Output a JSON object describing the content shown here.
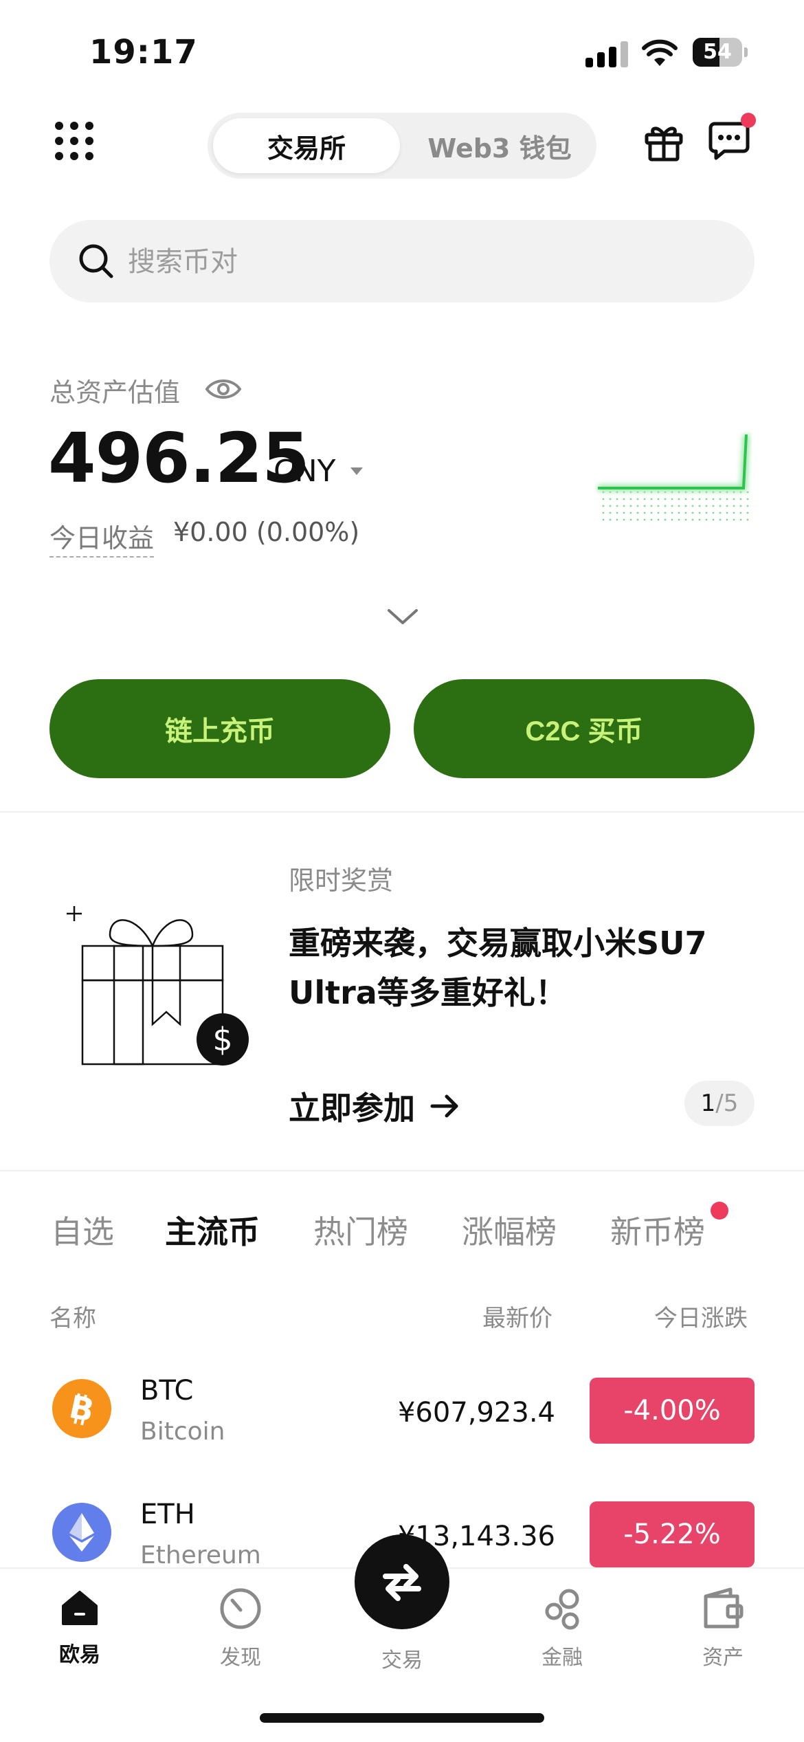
{
  "status_bar": {
    "time": "19:17",
    "battery": "54",
    "battery_level": 0.54
  },
  "header": {
    "tabs": [
      {
        "label": "交易所",
        "active": true
      },
      {
        "label": "Web3 钱包",
        "active": false
      }
    ]
  },
  "search": {
    "placeholder": "搜索币对"
  },
  "assets": {
    "label": "总资产估值",
    "value": "496.25",
    "currency": "CNY",
    "pnl_label": "今日收益",
    "pnl_value": "¥0.00 (0.00%)"
  },
  "actions": {
    "deposit": "链上充币",
    "buy": "C2C 买币"
  },
  "promo": {
    "subtitle": "限时奖赏",
    "title": "重磅来袭，交易赢取小米SU7 Ultra等多重好礼！",
    "cta": "立即参加",
    "page_current": "1",
    "page_total": "5"
  },
  "market_tabs": [
    {
      "label": "自选",
      "active": false
    },
    {
      "label": "主流币",
      "active": true
    },
    {
      "label": "热门榜",
      "active": false
    },
    {
      "label": "涨幅榜",
      "active": false
    },
    {
      "label": "新币榜",
      "active": false,
      "badge": true
    }
  ],
  "columns": {
    "name": "名称",
    "price": "最新价",
    "change": "今日涨跌"
  },
  "coins": [
    {
      "symbol": "BTC",
      "name": "Bitcoin",
      "price": "¥607,923.4",
      "change": "-4.00%",
      "icon": "bitcoin-icon",
      "color": "#f7931a"
    },
    {
      "symbol": "ETH",
      "name": "Ethereum",
      "price": "¥13,143.36",
      "change": "-5.22%",
      "icon": "ethereum-icon",
      "color": "#627eea"
    }
  ],
  "nav": [
    {
      "label": "欧易",
      "active": true
    },
    {
      "label": "发现"
    },
    {
      "label": "交易"
    },
    {
      "label": "金融"
    },
    {
      "label": "资产"
    }
  ],
  "colors": {
    "accent_green": "#2c6f12",
    "button_text": "#c9f27a",
    "down_red": "#e84469",
    "chart_green": "#2fc24f"
  }
}
